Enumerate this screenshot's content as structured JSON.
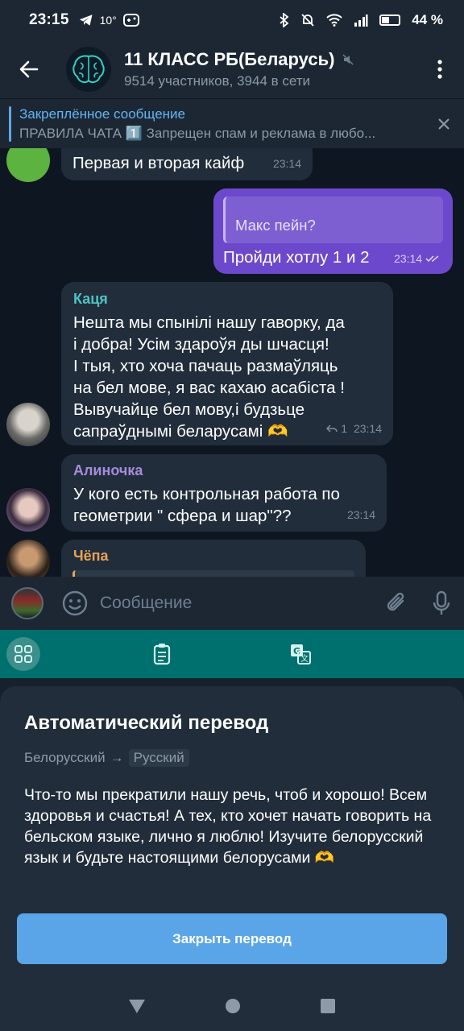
{
  "status": {
    "time": "23:15",
    "temp": "10°",
    "battery": "44 %",
    "battery_fraction": 0.44
  },
  "header": {
    "title": "11 КЛАСС РБ(Беларусь)",
    "subtitle": "9514 участников, 3944 в сети"
  },
  "pinned": {
    "title": "Закреплённое сообщение",
    "body": "ПРАВИЛА ЧАТА  1️⃣ Запрещен спам и реклама в любо..."
  },
  "messages": [
    {
      "text": "Первая и вторая кайф",
      "time": "23:14"
    },
    {
      "reply": "Макс пейн?",
      "text": "Пройди хотлу 1 и 2",
      "time": "23:14"
    },
    {
      "sender": "Каця",
      "text_lines": [
        "Нешта мы спынілі нашу гаворку, да",
        "і добра! Усім здароўя ды шчасця!",
        "І тыя, хто хоча пачаць размаўляць",
        "на бел мове, я вас кахаю асабіста !",
        "Вывучайце бел мову,і будзьце",
        "сапраўднымі беларусамі 🫶"
      ],
      "replies": "1",
      "time": "23:14"
    },
    {
      "sender": "Алиночка",
      "text_lines": [
        "У кого есть контрольная работа по",
        "геометрии \" сфера и шар\"??"
      ],
      "time": "23:14"
    },
    {
      "sender": "Чёпа"
    }
  ],
  "input": {
    "placeholder": "Сообщение"
  },
  "sheet": {
    "title": "Автоматический перевод",
    "from_lang": "Белорусский",
    "arrow": "→",
    "to_lang": "Русский",
    "text": "Что-то мы прекратили нашу речь, чтоб и хорошо! Всем здоровья и счастья! А тех, кто хочет начать говорить на бельском языке, лично я люблю! Изучите белорусский язык и будьте настоящими белорусами 🫶",
    "close_label": "Закрыть перевод"
  },
  "colors": {
    "accent": "#5aa5e7",
    "outgoing": "#6c49cc",
    "teal": "#00706e"
  }
}
